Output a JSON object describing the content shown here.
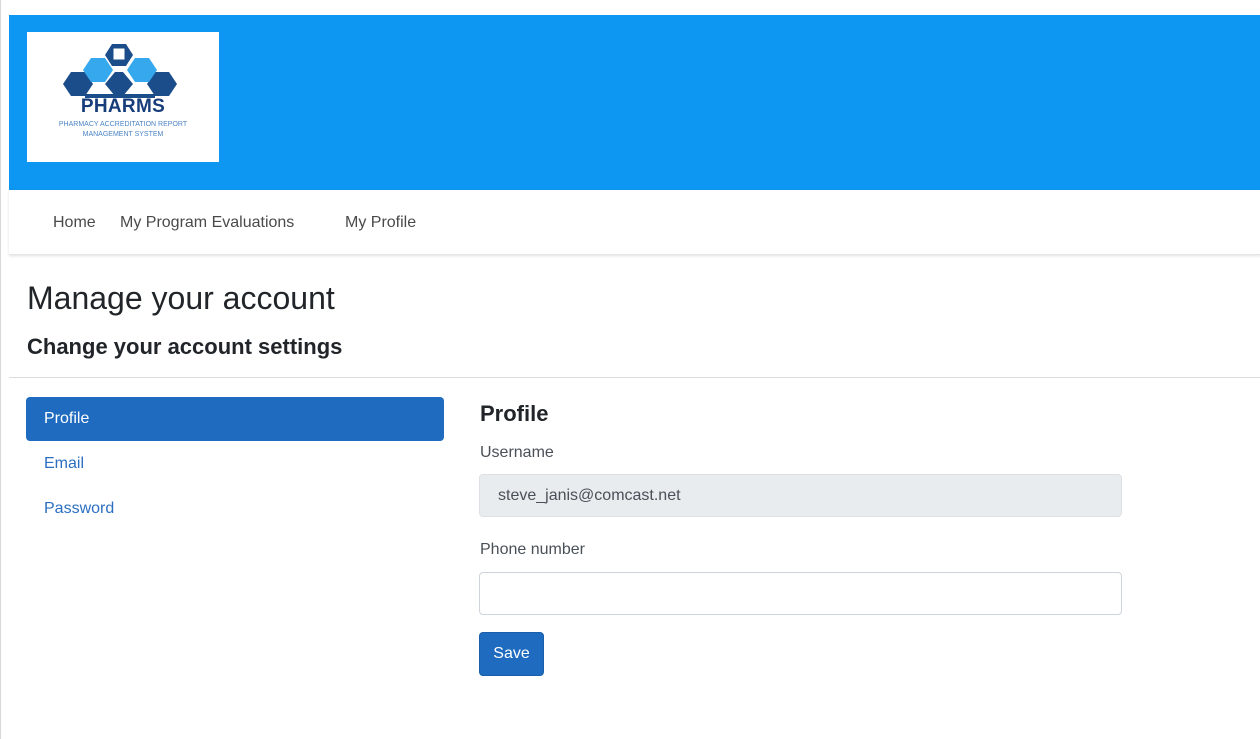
{
  "brand": {
    "title": "PHARMS",
    "subtitle_line1": "PHARMACY ACCREDITATION REPORT",
    "subtitle_line2": "MANAGEMENT SYSTEM",
    "colors": {
      "header": "#0d97f2",
      "navy": "#163d7a",
      "light_blue": "#35a8ee",
      "accent": "#1f6bbf"
    }
  },
  "nav": {
    "items": [
      {
        "label": "Home"
      },
      {
        "label": "My Program Evaluations"
      },
      {
        "label": "My Profile"
      }
    ]
  },
  "page": {
    "title": "Manage your account",
    "subtitle": "Change your account settings"
  },
  "sidebar": {
    "items": [
      {
        "label": "Profile",
        "active": true
      },
      {
        "label": "Email",
        "active": false
      },
      {
        "label": "Password",
        "active": false
      }
    ]
  },
  "profile": {
    "heading": "Profile",
    "username_label": "Username",
    "username_value": "steve_janis@comcast.net",
    "phone_label": "Phone number",
    "phone_value": "",
    "save_label": "Save"
  }
}
